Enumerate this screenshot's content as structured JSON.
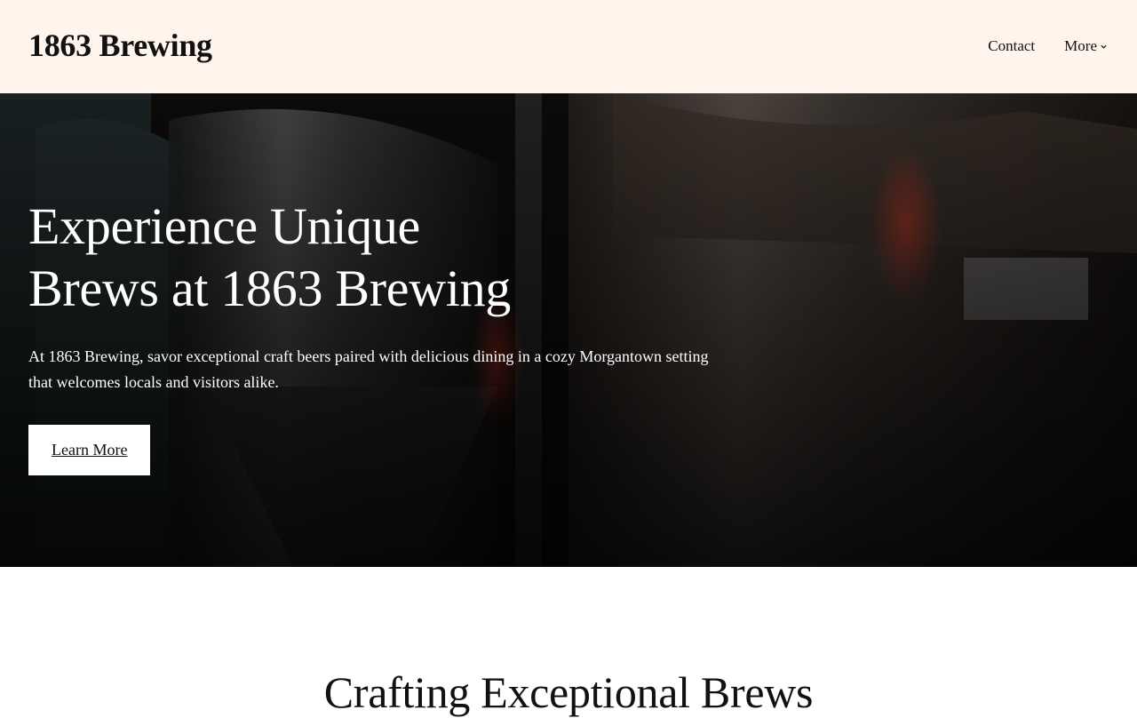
{
  "header": {
    "brand": "1863 Brewing",
    "nav": [
      {
        "label": "Contact"
      },
      {
        "label": "More"
      }
    ]
  },
  "hero": {
    "title_line1": "Experience Unique",
    "title_line2": "Brews at 1863 Brewing",
    "description": "At 1863 Brewing, savor exceptional craft beers paired with delicious dining in a cozy Morgantown setting that welcomes locals and visitors alike.",
    "button_label": "Learn More"
  },
  "intro": {
    "title": "Crafting Exceptional Brews"
  },
  "colors": {
    "header_bg": "#fff5ec",
    "hero_bg": "#0d0b0a",
    "button_bg": "#ffffff",
    "text_dark": "#111111"
  }
}
